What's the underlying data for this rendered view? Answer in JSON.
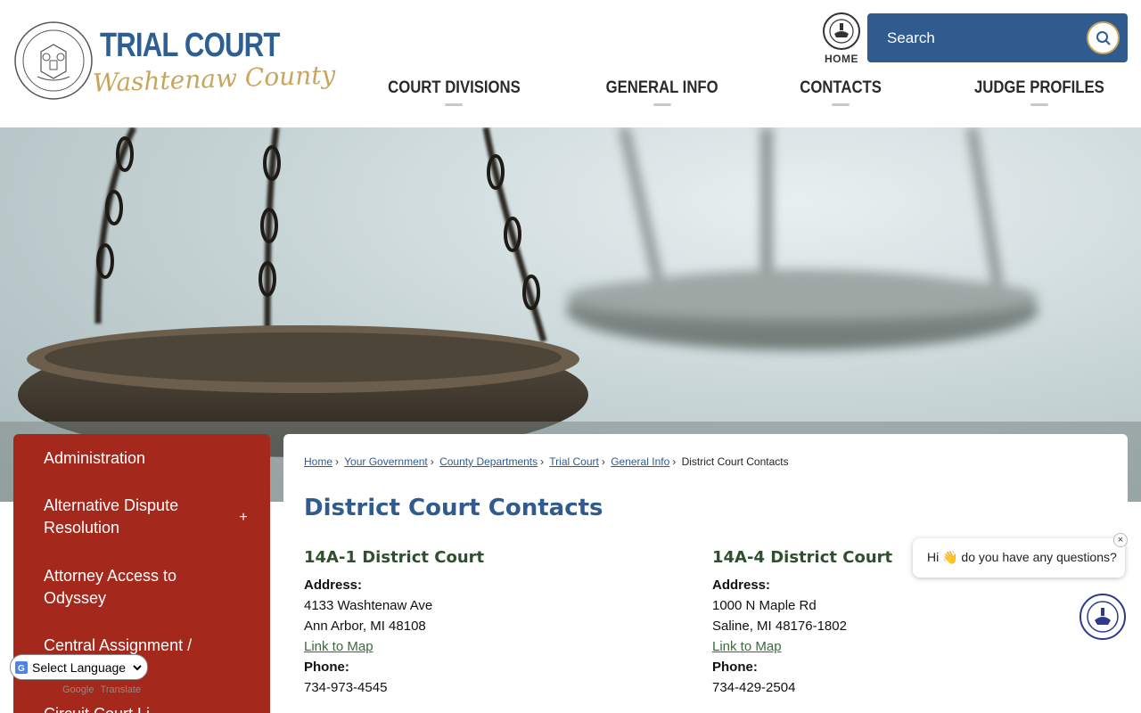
{
  "header": {
    "logo_title": "TRIAL COURT",
    "logo_subtitle": "Washtenaw County",
    "home_label": "HOME",
    "search": {
      "placeholder": "Search"
    },
    "nav": [
      {
        "label": "COURT DIVISIONS"
      },
      {
        "label": "GENERAL INFO"
      },
      {
        "label": "CONTACTS"
      },
      {
        "label": "JUDGE PROFILES"
      }
    ]
  },
  "sidebar": {
    "items": [
      {
        "label": "Administration"
      },
      {
        "label": "Alternative Dispute Resolution",
        "expand": "+"
      },
      {
        "label": "Attorney Access to Odyssey"
      },
      {
        "label": "Central Assignment /"
      },
      {
        "label": "Circuit Court Li..."
      }
    ]
  },
  "language": {
    "selected": "Select Language",
    "powered_by": "Powered by",
    "google": "Google",
    "translate": "Translate"
  },
  "breadcrumb": {
    "items": [
      "Home",
      "Your Government",
      "County Departments",
      "Trial Court",
      "General Info"
    ],
    "current": "District Court Contacts",
    "separator": "›"
  },
  "main": {
    "title": "District Court Contacts",
    "courts": [
      {
        "name": "14A-1 District Court",
        "address_label": "Address:",
        "address_line1": "4133 Washtenaw Ave",
        "address_line2": "Ann Arbor, MI 48108",
        "map_link": "Link to Map",
        "phone_label": "Phone:",
        "phone": "734-973-4545"
      },
      {
        "name": "14A-4 District Court",
        "address_label": "Address:",
        "address_line1": "1000 N Maple Rd",
        "address_line2": "Saline, MI 48176-1802",
        "map_link": "Link to Map",
        "phone_label": "Phone:",
        "phone": "734-429-2504"
      }
    ]
  },
  "chat": {
    "message": "Hi 👋 do you have any questions?",
    "close": "×"
  },
  "colors": {
    "brand_blue": "#2f5b8e",
    "gold": "#c9a55c",
    "sidebar_red": "#a5281d",
    "court_green": "#2f4f2f"
  }
}
